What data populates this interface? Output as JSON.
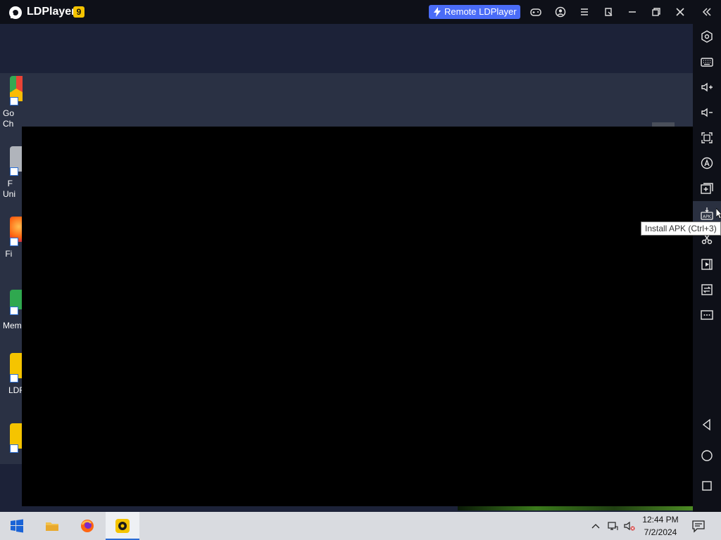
{
  "app": {
    "title": "LDPlayer",
    "version": "9"
  },
  "header": {
    "remote_label": "Remote LDPlayer"
  },
  "desktop": {
    "icons": [
      {
        "label": "Go\nCh",
        "name": "chrome"
      },
      {
        "label": "F\nUni",
        "name": "uninstall"
      },
      {
        "label": "Fi",
        "name": "firefox"
      },
      {
        "label": "Mem",
        "name": "memu"
      },
      {
        "label": "LDF",
        "name": "ldplayer"
      },
      {
        "label": "",
        "name": "ldplayer2"
      }
    ]
  },
  "sidebar": {
    "tooltip": "Install APK (Ctrl+3)",
    "items": [
      "settings-icon",
      "keyboard-icon",
      "volume-up-icon",
      "volume-down-icon",
      "screenshot-icon",
      "auto-translate-icon",
      "add-window-icon",
      "install-apk-icon",
      "scissors-icon",
      "record-icon",
      "sync-icon",
      "more-icon"
    ],
    "nav": [
      "back-icon",
      "home-icon",
      "recents-icon"
    ]
  },
  "taskbar": {
    "time": "12:44 PM",
    "date": "7/2/2024"
  },
  "colors": {
    "accent": "#4a6cf7",
    "badge": "#f5c400",
    "titlebar": "#0e1018"
  }
}
